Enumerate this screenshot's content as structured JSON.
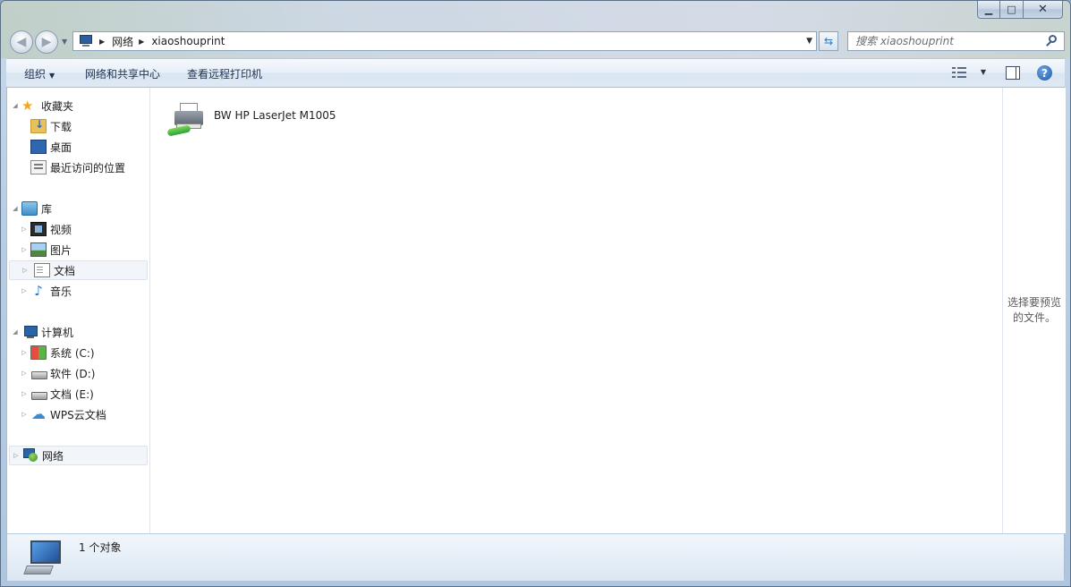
{
  "window": {
    "caption": {
      "minimize": "▁",
      "maximize": "□",
      "close": "✕"
    }
  },
  "nav": {
    "back_icon": "back-arrow-icon",
    "forward_icon": "forward-arrow-icon"
  },
  "address": {
    "breadcrumbs": [
      "网络",
      "xiaoshouprint"
    ]
  },
  "search": {
    "placeholder": "搜索 xiaoshouprint"
  },
  "toolbar": {
    "organize_label": "组织",
    "network_center_label": "网络和共享中心",
    "remote_printers_label": "查看远程打印机"
  },
  "sidebar": {
    "favorites": {
      "label": "收藏夹",
      "items": [
        {
          "label": "下载",
          "icon": "download-folder-icon"
        },
        {
          "label": "桌面",
          "icon": "desktop-icon"
        },
        {
          "label": "最近访问的位置",
          "icon": "recent-places-icon"
        }
      ]
    },
    "libraries": {
      "label": "库",
      "items": [
        {
          "label": "视频",
          "icon": "video-icon"
        },
        {
          "label": "图片",
          "icon": "picture-icon"
        },
        {
          "label": "文档",
          "icon": "document-icon"
        },
        {
          "label": "音乐",
          "icon": "music-icon"
        }
      ]
    },
    "computer": {
      "label": "计算机",
      "items": [
        {
          "label": "系统 (C:)",
          "icon": "system-drive-icon"
        },
        {
          "label": "软件 (D:)",
          "icon": "drive-icon"
        },
        {
          "label": "文档 (E:)",
          "icon": "drive-icon"
        },
        {
          "label": "WPS云文档",
          "icon": "cloud-icon"
        }
      ]
    },
    "network": {
      "label": "网络"
    }
  },
  "content": {
    "items": [
      {
        "name": "BW HP LaserJet M1005",
        "icon": "printer-icon"
      }
    ]
  },
  "preview": {
    "text": "选择要预览的文件。"
  },
  "status": {
    "count_text": "1 个对象"
  },
  "colors": {
    "accent": "#2f7ac3",
    "toolbar_text": "#1e3250"
  }
}
